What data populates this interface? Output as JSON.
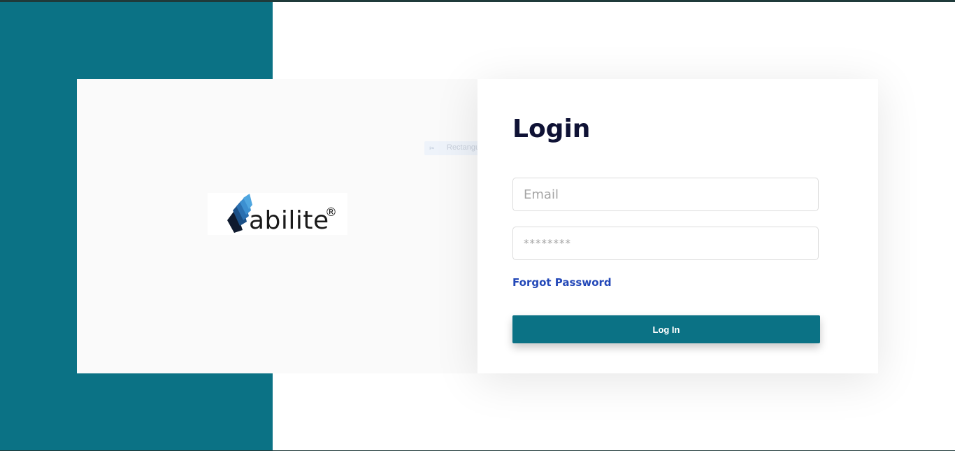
{
  "logo": {
    "text": "abilite",
    "registered_mark": "®",
    "colors": {
      "accent_light": "#4fa6e0",
      "accent_mid": "#2a6fb0",
      "accent_dark": "#0f1a2e"
    }
  },
  "overlay": {
    "snip_label": "Rectangular Snip",
    "icon": "scissors-icon"
  },
  "login": {
    "title": "Login",
    "email_placeholder": "Email",
    "password_placeholder": "********",
    "forgot_password": "Forgot Password",
    "submit_label": "Log In"
  },
  "colors": {
    "brand_teal": "#0b7285",
    "title": "#0f1235",
    "link": "#2348b8",
    "left_card_bg": "#fafafa"
  }
}
